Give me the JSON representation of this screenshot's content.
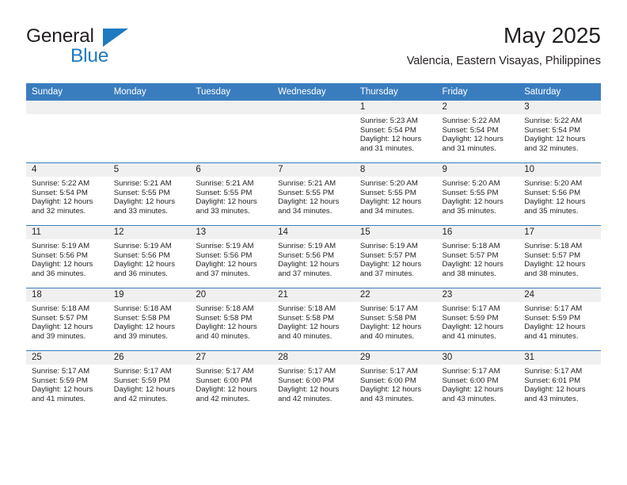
{
  "brand": {
    "name_part1": "General",
    "name_part2": "Blue",
    "icon": "triangle-logo"
  },
  "header": {
    "month_year": "May 2025",
    "location": "Valencia, Eastern Visayas, Philippines"
  },
  "colors": {
    "header_blue": "#3a7dbf",
    "brand_blue": "#1f7ac0",
    "daynum_bar": "#f0f0f0",
    "text": "#231f20"
  },
  "weekday_headers": [
    "Sunday",
    "Monday",
    "Tuesday",
    "Wednesday",
    "Thursday",
    "Friday",
    "Saturday"
  ],
  "labels": {
    "sunrise_prefix": "Sunrise:",
    "sunset_prefix": "Sunset:",
    "daylight_prefix": "Daylight:"
  },
  "weeks": [
    [
      {
        "day": "",
        "sunrise": "",
        "sunset": "",
        "daylight_l1": "",
        "daylight_l2": "",
        "empty": true
      },
      {
        "day": "",
        "sunrise": "",
        "sunset": "",
        "daylight_l1": "",
        "daylight_l2": "",
        "empty": true
      },
      {
        "day": "",
        "sunrise": "",
        "sunset": "",
        "daylight_l1": "",
        "daylight_l2": "",
        "empty": true
      },
      {
        "day": "",
        "sunrise": "",
        "sunset": "",
        "daylight_l1": "",
        "daylight_l2": "",
        "empty": true
      },
      {
        "day": "1",
        "sunrise": "Sunrise: 5:23 AM",
        "sunset": "Sunset: 5:54 PM",
        "daylight_l1": "Daylight: 12 hours",
        "daylight_l2": "and 31 minutes.",
        "empty": false
      },
      {
        "day": "2",
        "sunrise": "Sunrise: 5:22 AM",
        "sunset": "Sunset: 5:54 PM",
        "daylight_l1": "Daylight: 12 hours",
        "daylight_l2": "and 31 minutes.",
        "empty": false
      },
      {
        "day": "3",
        "sunrise": "Sunrise: 5:22 AM",
        "sunset": "Sunset: 5:54 PM",
        "daylight_l1": "Daylight: 12 hours",
        "daylight_l2": "and 32 minutes.",
        "empty": false
      }
    ],
    [
      {
        "day": "4",
        "sunrise": "Sunrise: 5:22 AM",
        "sunset": "Sunset: 5:54 PM",
        "daylight_l1": "Daylight: 12 hours",
        "daylight_l2": "and 32 minutes.",
        "empty": false
      },
      {
        "day": "5",
        "sunrise": "Sunrise: 5:21 AM",
        "sunset": "Sunset: 5:55 PM",
        "daylight_l1": "Daylight: 12 hours",
        "daylight_l2": "and 33 minutes.",
        "empty": false
      },
      {
        "day": "6",
        "sunrise": "Sunrise: 5:21 AM",
        "sunset": "Sunset: 5:55 PM",
        "daylight_l1": "Daylight: 12 hours",
        "daylight_l2": "and 33 minutes.",
        "empty": false
      },
      {
        "day": "7",
        "sunrise": "Sunrise: 5:21 AM",
        "sunset": "Sunset: 5:55 PM",
        "daylight_l1": "Daylight: 12 hours",
        "daylight_l2": "and 34 minutes.",
        "empty": false
      },
      {
        "day": "8",
        "sunrise": "Sunrise: 5:20 AM",
        "sunset": "Sunset: 5:55 PM",
        "daylight_l1": "Daylight: 12 hours",
        "daylight_l2": "and 34 minutes.",
        "empty": false
      },
      {
        "day": "9",
        "sunrise": "Sunrise: 5:20 AM",
        "sunset": "Sunset: 5:55 PM",
        "daylight_l1": "Daylight: 12 hours",
        "daylight_l2": "and 35 minutes.",
        "empty": false
      },
      {
        "day": "10",
        "sunrise": "Sunrise: 5:20 AM",
        "sunset": "Sunset: 5:56 PM",
        "daylight_l1": "Daylight: 12 hours",
        "daylight_l2": "and 35 minutes.",
        "empty": false
      }
    ],
    [
      {
        "day": "11",
        "sunrise": "Sunrise: 5:19 AM",
        "sunset": "Sunset: 5:56 PM",
        "daylight_l1": "Daylight: 12 hours",
        "daylight_l2": "and 36 minutes.",
        "empty": false
      },
      {
        "day": "12",
        "sunrise": "Sunrise: 5:19 AM",
        "sunset": "Sunset: 5:56 PM",
        "daylight_l1": "Daylight: 12 hours",
        "daylight_l2": "and 36 minutes.",
        "empty": false
      },
      {
        "day": "13",
        "sunrise": "Sunrise: 5:19 AM",
        "sunset": "Sunset: 5:56 PM",
        "daylight_l1": "Daylight: 12 hours",
        "daylight_l2": "and 37 minutes.",
        "empty": false
      },
      {
        "day": "14",
        "sunrise": "Sunrise: 5:19 AM",
        "sunset": "Sunset: 5:56 PM",
        "daylight_l1": "Daylight: 12 hours",
        "daylight_l2": "and 37 minutes.",
        "empty": false
      },
      {
        "day": "15",
        "sunrise": "Sunrise: 5:19 AM",
        "sunset": "Sunset: 5:57 PM",
        "daylight_l1": "Daylight: 12 hours",
        "daylight_l2": "and 37 minutes.",
        "empty": false
      },
      {
        "day": "16",
        "sunrise": "Sunrise: 5:18 AM",
        "sunset": "Sunset: 5:57 PM",
        "daylight_l1": "Daylight: 12 hours",
        "daylight_l2": "and 38 minutes.",
        "empty": false
      },
      {
        "day": "17",
        "sunrise": "Sunrise: 5:18 AM",
        "sunset": "Sunset: 5:57 PM",
        "daylight_l1": "Daylight: 12 hours",
        "daylight_l2": "and 38 minutes.",
        "empty": false
      }
    ],
    [
      {
        "day": "18",
        "sunrise": "Sunrise: 5:18 AM",
        "sunset": "Sunset: 5:57 PM",
        "daylight_l1": "Daylight: 12 hours",
        "daylight_l2": "and 39 minutes.",
        "empty": false
      },
      {
        "day": "19",
        "sunrise": "Sunrise: 5:18 AM",
        "sunset": "Sunset: 5:58 PM",
        "daylight_l1": "Daylight: 12 hours",
        "daylight_l2": "and 39 minutes.",
        "empty": false
      },
      {
        "day": "20",
        "sunrise": "Sunrise: 5:18 AM",
        "sunset": "Sunset: 5:58 PM",
        "daylight_l1": "Daylight: 12 hours",
        "daylight_l2": "and 40 minutes.",
        "empty": false
      },
      {
        "day": "21",
        "sunrise": "Sunrise: 5:18 AM",
        "sunset": "Sunset: 5:58 PM",
        "daylight_l1": "Daylight: 12 hours",
        "daylight_l2": "and 40 minutes.",
        "empty": false
      },
      {
        "day": "22",
        "sunrise": "Sunrise: 5:17 AM",
        "sunset": "Sunset: 5:58 PM",
        "daylight_l1": "Daylight: 12 hours",
        "daylight_l2": "and 40 minutes.",
        "empty": false
      },
      {
        "day": "23",
        "sunrise": "Sunrise: 5:17 AM",
        "sunset": "Sunset: 5:59 PM",
        "daylight_l1": "Daylight: 12 hours",
        "daylight_l2": "and 41 minutes.",
        "empty": false
      },
      {
        "day": "24",
        "sunrise": "Sunrise: 5:17 AM",
        "sunset": "Sunset: 5:59 PM",
        "daylight_l1": "Daylight: 12 hours",
        "daylight_l2": "and 41 minutes.",
        "empty": false
      }
    ],
    [
      {
        "day": "25",
        "sunrise": "Sunrise: 5:17 AM",
        "sunset": "Sunset: 5:59 PM",
        "daylight_l1": "Daylight: 12 hours",
        "daylight_l2": "and 41 minutes.",
        "empty": false
      },
      {
        "day": "26",
        "sunrise": "Sunrise: 5:17 AM",
        "sunset": "Sunset: 5:59 PM",
        "daylight_l1": "Daylight: 12 hours",
        "daylight_l2": "and 42 minutes.",
        "empty": false
      },
      {
        "day": "27",
        "sunrise": "Sunrise: 5:17 AM",
        "sunset": "Sunset: 6:00 PM",
        "daylight_l1": "Daylight: 12 hours",
        "daylight_l2": "and 42 minutes.",
        "empty": false
      },
      {
        "day": "28",
        "sunrise": "Sunrise: 5:17 AM",
        "sunset": "Sunset: 6:00 PM",
        "daylight_l1": "Daylight: 12 hours",
        "daylight_l2": "and 42 minutes.",
        "empty": false
      },
      {
        "day": "29",
        "sunrise": "Sunrise: 5:17 AM",
        "sunset": "Sunset: 6:00 PM",
        "daylight_l1": "Daylight: 12 hours",
        "daylight_l2": "and 43 minutes.",
        "empty": false
      },
      {
        "day": "30",
        "sunrise": "Sunrise: 5:17 AM",
        "sunset": "Sunset: 6:00 PM",
        "daylight_l1": "Daylight: 12 hours",
        "daylight_l2": "and 43 minutes.",
        "empty": false
      },
      {
        "day": "31",
        "sunrise": "Sunrise: 5:17 AM",
        "sunset": "Sunset: 6:01 PM",
        "daylight_l1": "Daylight: 12 hours",
        "daylight_l2": "and 43 minutes.",
        "empty": false
      }
    ]
  ]
}
